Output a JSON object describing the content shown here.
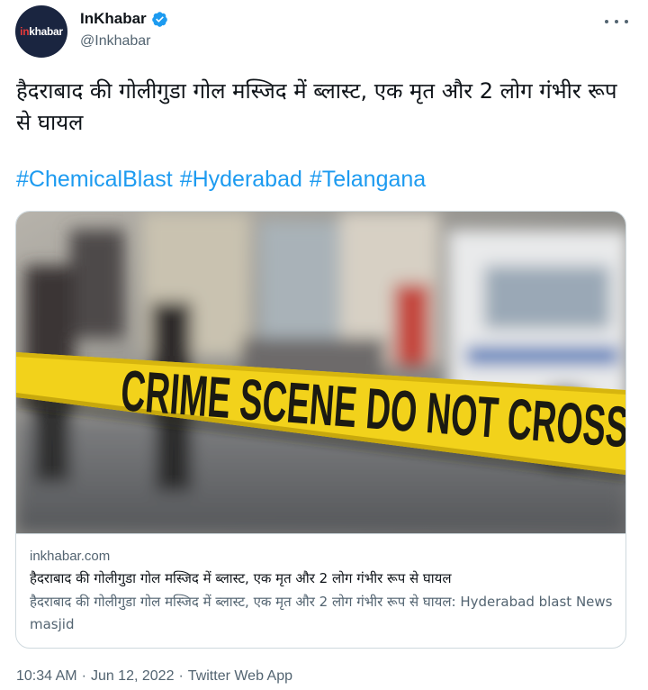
{
  "author": {
    "display_name": "InKhabar",
    "handle": "@Inkhabar",
    "avatar_text_accent": "in",
    "avatar_text_rest": "khabar",
    "avatar_bg": "#1a2540",
    "verified_color": "#1d9bf0"
  },
  "tweet": {
    "text": "हैदराबाद की गोलीगुडा गोल मस्जिद में ब्लास्ट, एक मृत और 2 लोग गंभीर रूप से घायल",
    "hashtags": [
      "#ChemicalBlast",
      "#Hyderabad",
      "#Telangana"
    ]
  },
  "card": {
    "image_tape_text": "CRIME SCENE DO NOT CROSS",
    "domain": "inkhabar.com",
    "title": "हैदराबाद की गोलीगुडा गोल मस्जिद में ब्लास्ट, एक मृत और 2 लोग गंभीर रूप से घायल",
    "description": "हैदराबाद की गोलीगुडा गोल मस्जिद में ब्लास्ट, एक मृत और 2 लोग गंभीर रूप से घायल: Hyderabad blast News masjid"
  },
  "meta": {
    "time": "10:34 AM",
    "date": "Jun 12, 2022",
    "source": "Twitter Web App",
    "separator": "·"
  },
  "colors": {
    "link": "#1d9bf0",
    "secondary_text": "#536471",
    "tape_yellow": "#f2d21b"
  }
}
